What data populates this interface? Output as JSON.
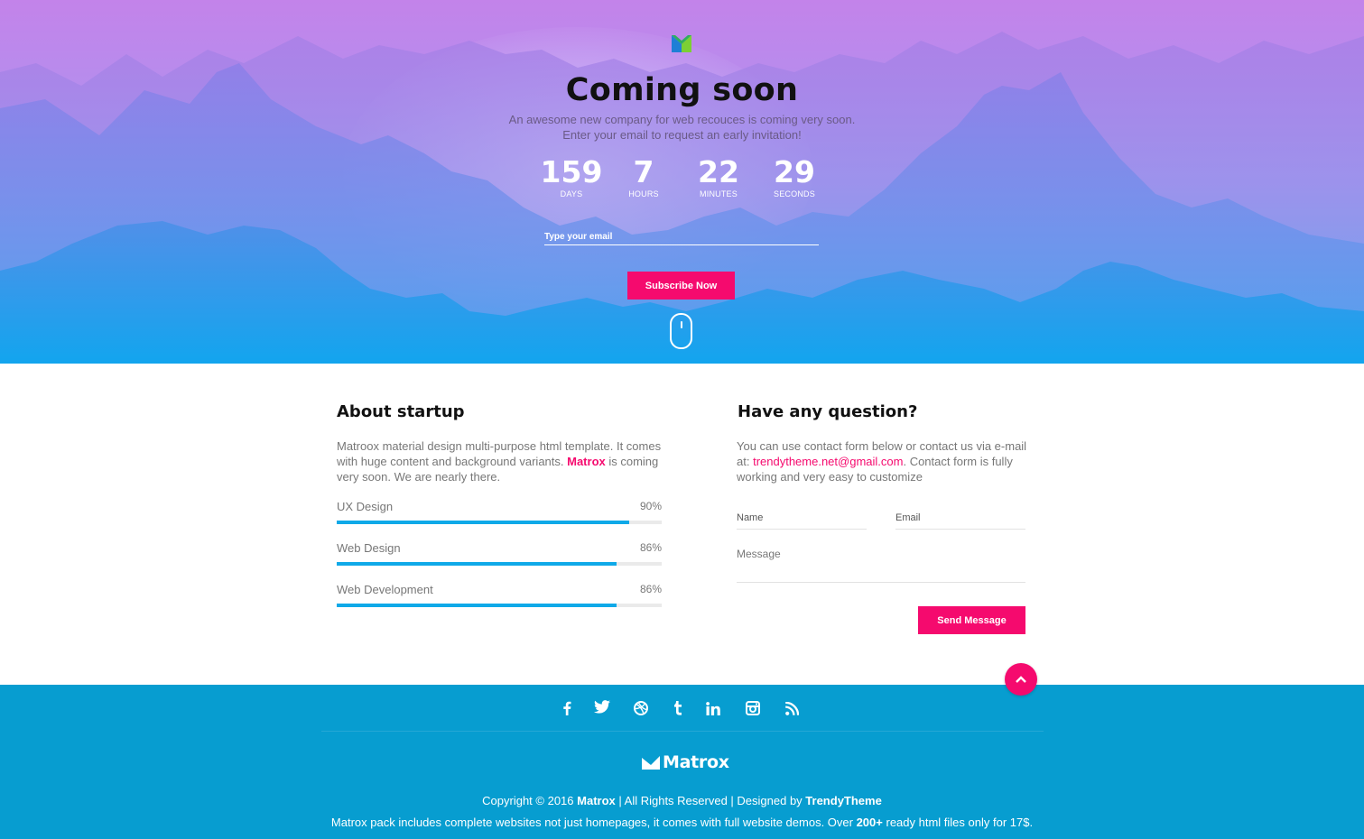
{
  "hero": {
    "title": "Coming soon",
    "subtitle_line1": "An awesome new company for web recouces is coming very soon.",
    "subtitle_line2": "Enter your email to request an early invitation!",
    "countdown": [
      {
        "value": "159",
        "label": "DAYS"
      },
      {
        "value": "7",
        "label": "HOURS"
      },
      {
        "value": "22",
        "label": "MINUTES"
      },
      {
        "value": "29",
        "label": "SECONDS"
      }
    ],
    "email_placeholder": "Type your email",
    "subscribe_label": "Subscribe Now"
  },
  "about": {
    "title": "About startup",
    "text_line1": "Matroox material design multi-purpose html template. It comes",
    "text_line2_pre": "with huge content and background variants. ",
    "text_line2_brand": "Matrox",
    "text_line2_post": " is coming",
    "text_line3": "very soon. We are nearly there.",
    "skills": [
      {
        "name": "UX Design",
        "percent_label": "90%",
        "value": 90
      },
      {
        "name": "Web Design",
        "percent_label": "86%",
        "value": 86
      },
      {
        "name": "Web Development",
        "percent_label": "86%",
        "value": 86
      }
    ]
  },
  "contact": {
    "title": "Have any question?",
    "text_line1": "You can use contact form below or contact us via e-mail",
    "text_line2_pre": "at: ",
    "email": "trendytheme.net@gmail.com",
    "text_line2_post": ". Contact form is fully",
    "text_line3": "working and very easy to customize",
    "name_label": "Name",
    "email_label": "Email",
    "message_label": "Message",
    "send_label": "Send Message"
  },
  "footer": {
    "social_icons": [
      "facebook-icon",
      "twitter-icon",
      "dribbble-icon",
      "tumblr-icon",
      "linkedin-icon",
      "instagram-icon",
      "rss-icon"
    ],
    "logo_text": "Matrox",
    "copyright_pre": "Copyright © 2016 ",
    "copyright_brand": "Matrox",
    "copyright_mid": " | All Rights Reserved | Designed by ",
    "copyright_designer": "TrendyTheme",
    "promo_pre": "Matrox pack includes complete websites not just homepages, it comes with full website demos. Over ",
    "promo_count": "200+",
    "promo_post": " ready html files only for 17$."
  },
  "colors": {
    "accent_pink": "#f50a6e",
    "footer_blue": "#079dd0",
    "progress_blue": "#0fa9e8"
  }
}
